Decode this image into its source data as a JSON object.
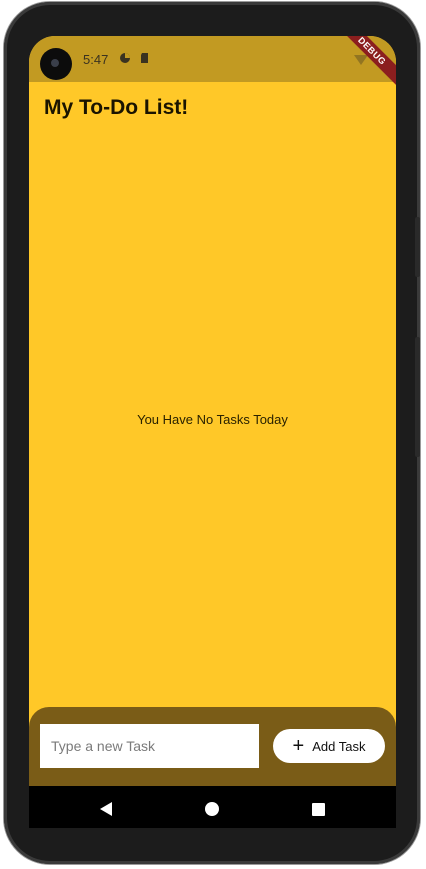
{
  "status_bar": {
    "time": "5:47",
    "debug_banner": "DEBUG"
  },
  "app": {
    "title": "My To-Do List!",
    "empty_message": "You Have No Tasks Today"
  },
  "composer": {
    "input_value": "",
    "input_placeholder": "Type a new Task",
    "add_button_label": "Add Task",
    "add_button_icon": "plus-icon"
  },
  "colors": {
    "background": "#FFC828",
    "status_bar": "#C29A22",
    "bottom_panel": "#7A5C17"
  },
  "nav_bar": {
    "icons": [
      "back-icon",
      "home-icon",
      "recents-icon"
    ]
  }
}
